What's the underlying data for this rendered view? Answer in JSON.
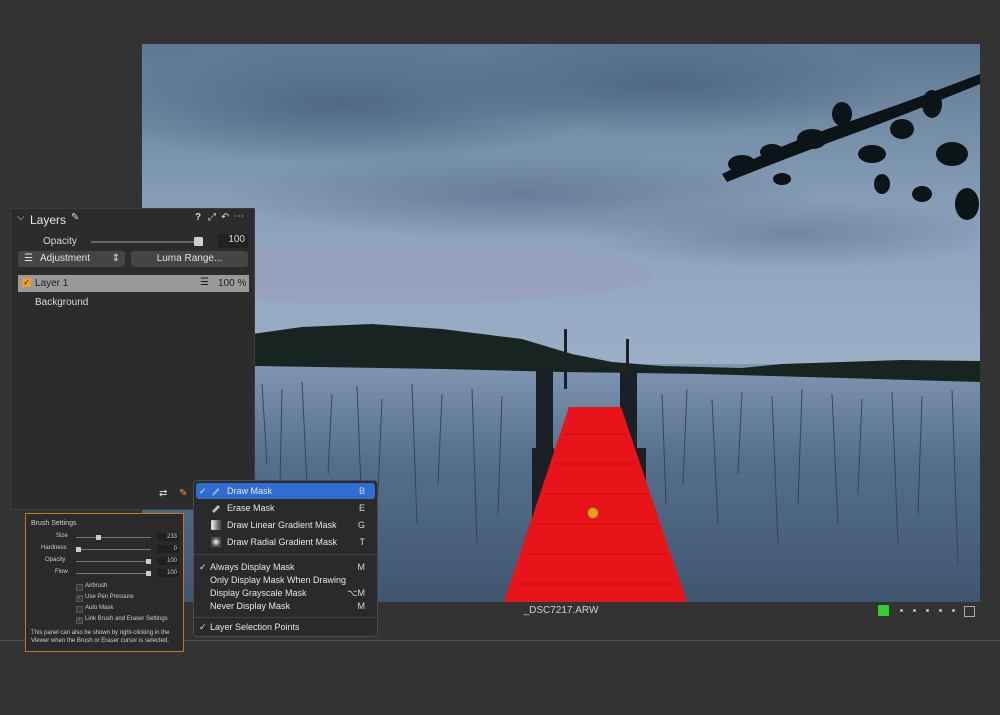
{
  "viewer": {
    "filename": "_DSC7217.ARW"
  },
  "layers_panel": {
    "title": "Layers",
    "header_icons": [
      "brush-icon",
      "help-icon",
      "expand-icon",
      "undo-icon",
      "more-icon"
    ],
    "opacity_label": "Opacity",
    "opacity_value": "100",
    "adjustment_dropdown": "Adjustment",
    "luma_button": "Luma Range...",
    "layers": [
      {
        "name": "Layer 1",
        "opacity": "100 %",
        "checked": true,
        "selected": true
      },
      {
        "name": "Background"
      }
    ],
    "footer_icons": [
      "adjust-icon",
      "brush-tool-icon"
    ]
  },
  "brush_settings": {
    "title": "Brush Settings",
    "sliders": [
      {
        "label": "Size",
        "value": "233",
        "fraction": 0.2
      },
      {
        "label": "Hardness",
        "value": "0",
        "fraction": 0.0
      },
      {
        "label": "Opacity",
        "value": "100",
        "fraction": 1.0
      },
      {
        "label": "Flow",
        "value": "100",
        "fraction": 1.0
      }
    ],
    "options": [
      {
        "label": "Airbrush",
        "checked": false
      },
      {
        "label": "Use Pen Pressure",
        "checked": true
      },
      {
        "label": "Auto Mask",
        "checked": false
      },
      {
        "label": "Link Brush and Eraser Settings",
        "checked": true
      }
    ],
    "note": "This panel can also be shown by right-clicking in the Viewer when the Brush or Eraser cursor is selected."
  },
  "context_menu": {
    "group1": [
      {
        "label": "Draw Mask",
        "key": "B",
        "checked": true,
        "selected": true,
        "icon": "brush-icon"
      },
      {
        "label": "Erase Mask",
        "key": "E",
        "checked": false,
        "icon": "eraser-icon"
      },
      {
        "label": "Draw Linear Gradient Mask",
        "key": "G",
        "checked": false,
        "icon": "linear-gradient-icon"
      },
      {
        "label": "Draw Radial Gradient Mask",
        "key": "T",
        "checked": false,
        "icon": "radial-gradient-icon"
      }
    ],
    "group2": [
      {
        "label": "Always Display Mask",
        "key": "M",
        "checked": true
      },
      {
        "label": "Only Display Mask When Drawing",
        "key": "",
        "checked": false
      },
      {
        "label": "Display Grayscale Mask",
        "key": "⌥M",
        "checked": false
      },
      {
        "label": "Never Display Mask",
        "key": "M",
        "checked": false
      }
    ],
    "group3": [
      {
        "label": "Layer Selection Points",
        "key": "",
        "checked": true
      }
    ],
    "check_mark": "✓"
  },
  "colors": {
    "mask": "#e8141a",
    "selection": "#2f6dd2",
    "accent": "#f0a020",
    "active_thumb": "#2fd02f"
  }
}
